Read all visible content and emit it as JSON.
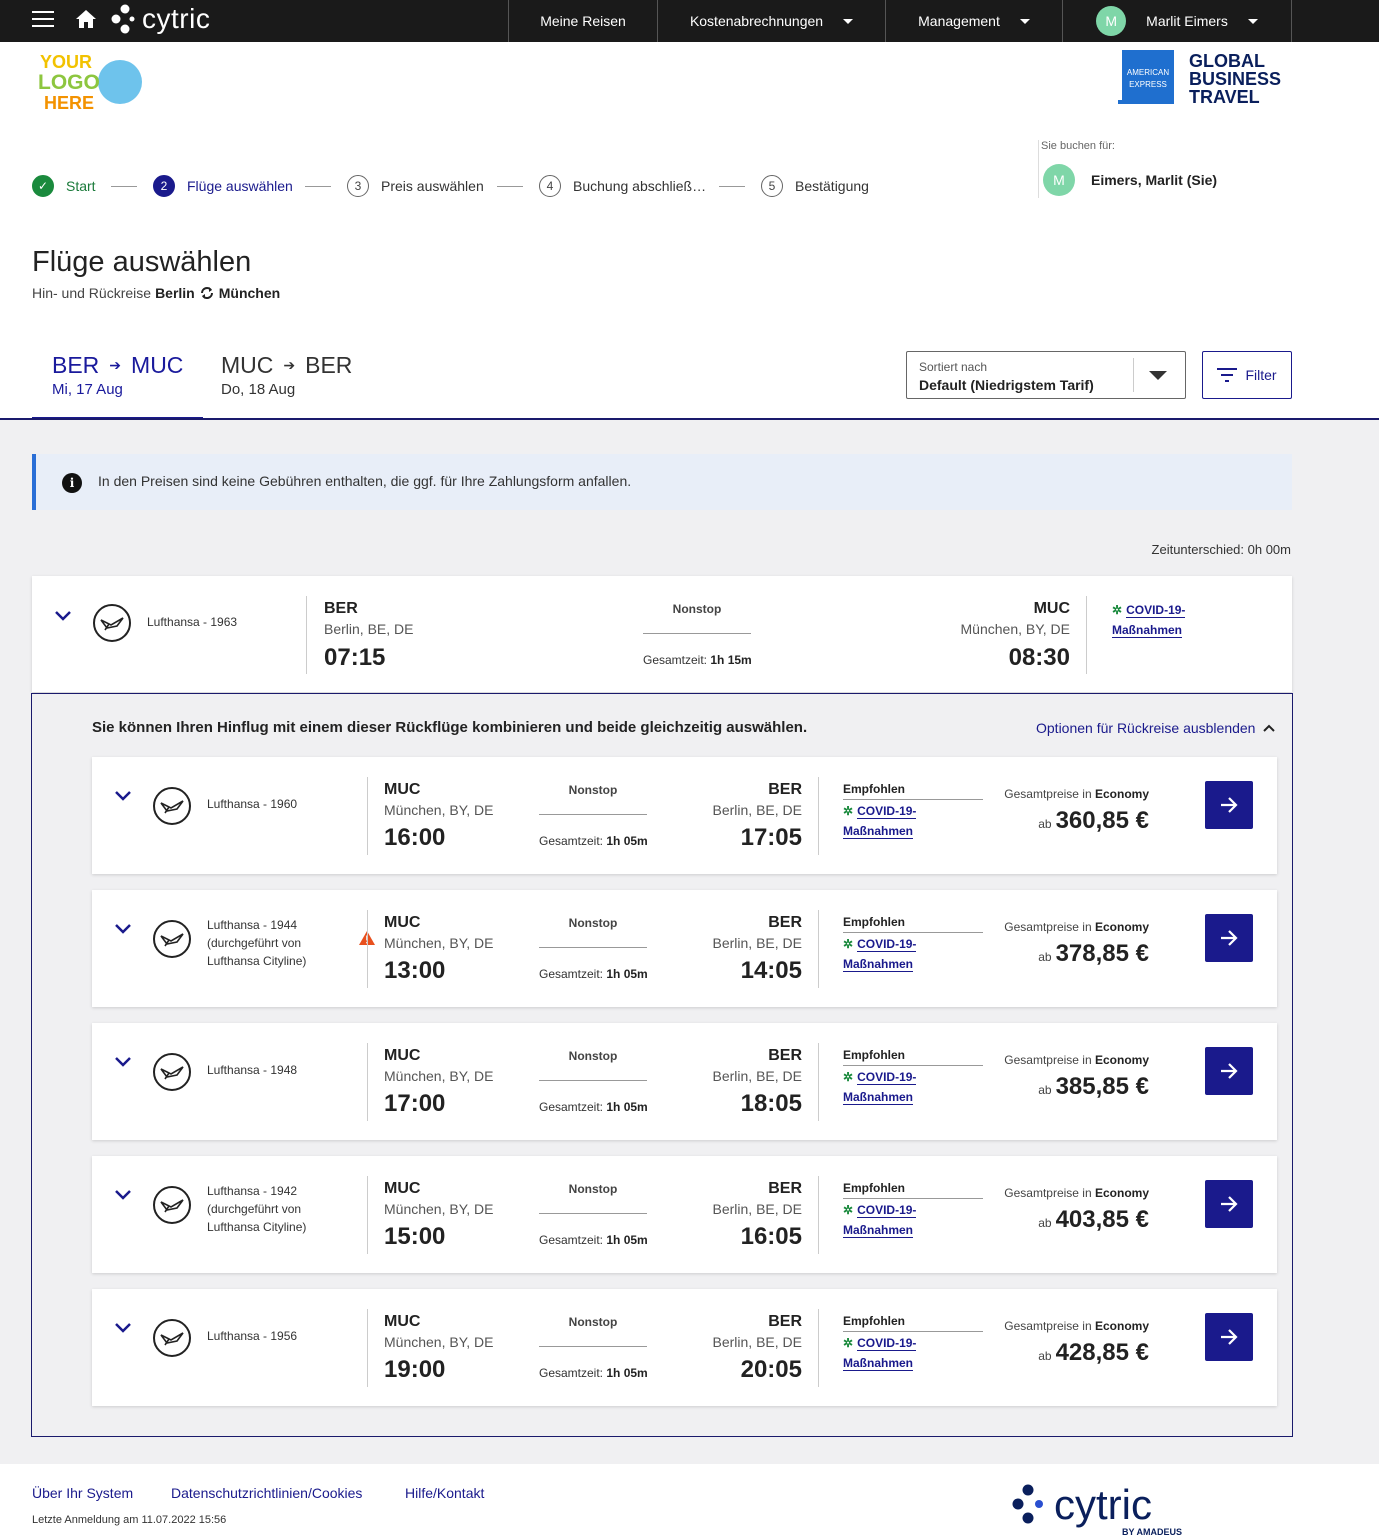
{
  "topbar": {
    "brand": "cytric",
    "nav": [
      {
        "label": "Meine Reisen",
        "dropdown": false
      },
      {
        "label": "Kostenabrechnungen",
        "dropdown": true
      },
      {
        "label": "Management",
        "dropdown": true
      }
    ],
    "user": {
      "initial": "M",
      "name": "Marlit Eimers"
    }
  },
  "logos": {
    "your_logo": [
      "YOUR",
      "LOGO",
      "HERE"
    ],
    "amex_badge": [
      "AMERICAN",
      "EXPRESS"
    ],
    "amex_text": [
      "GLOBAL",
      "BUSINESS",
      "TRAVEL"
    ]
  },
  "stepper": [
    {
      "num": "",
      "label": "Start",
      "state": "done"
    },
    {
      "num": "2",
      "label": "Flüge auswählen",
      "state": "active"
    },
    {
      "num": "3",
      "label": "Preis auswählen",
      "state": "todo"
    },
    {
      "num": "4",
      "label": "Buchung abschließ…",
      "state": "todo"
    },
    {
      "num": "5",
      "label": "Bestätigung",
      "state": "todo"
    }
  ],
  "booking_for": {
    "label": "Sie buchen für:",
    "initial": "M",
    "name": "Eimers, Marlit (Sie)"
  },
  "page": {
    "title": "Flüge auswählen",
    "subtitle_prefix": "Hin- und Rückreise",
    "from": "Berlin",
    "to": "München"
  },
  "tabs": [
    {
      "from": "BER",
      "to": "MUC",
      "date": "Mi, 17 Aug",
      "active": true
    },
    {
      "from": "MUC",
      "to": "BER",
      "date": "Do, 18 Aug",
      "active": false
    }
  ],
  "sort": {
    "label": "Sortiert nach",
    "value": "Default (Niedrigstem Tarif)"
  },
  "filter_label": "Filter",
  "info_text": "In den Preisen sind keine Gebühren enthalten, die ggf. für Ihre Zahlungsform anfallen.",
  "timezone_note": "Zeitunterschied: 0h 00m",
  "outbound": {
    "airline": "Lufthansa - 1963",
    "dep_code": "BER",
    "dep_city": "Berlin, BE, DE",
    "dep_time": "07:15",
    "stops": "Nonstop",
    "duration_label": "Gesamtzeit:",
    "duration": "1h 15m",
    "arr_code": "MUC",
    "arr_city": "München, BY, DE",
    "arr_time": "08:30",
    "covid": [
      "COVID-19-",
      "Maßnahmen"
    ]
  },
  "combo": {
    "title": "Sie können Ihren Hinflug mit einem dieser Rückflüge kombinieren und beide gleichzeitig auswählen.",
    "hide_label": "Optionen für Rückreise ausblenden"
  },
  "returns": [
    {
      "airline": [
        "Lufthansa - 1960"
      ],
      "warning": false,
      "dep_code": "MUC",
      "dep_city": "München, BY, DE",
      "dep_time": "16:00",
      "stops": "Nonstop",
      "duration_label": "Gesamtzeit:",
      "duration": "1h 05m",
      "arr_code": "BER",
      "arr_city": "Berlin, BE, DE",
      "arr_time": "17:05",
      "tag": "Empfohlen",
      "covid": [
        "COVID-19-",
        "Maßnahmen"
      ],
      "price_label": "Gesamtpreise in",
      "cabin": "Economy",
      "price_prefix": "ab",
      "price": "360,85 €"
    },
    {
      "airline": [
        "Lufthansa - 1944",
        "(durchgeführt von",
        "Lufthansa Cityline)"
      ],
      "warning": true,
      "dep_code": "MUC",
      "dep_city": "München, BY, DE",
      "dep_time": "13:00",
      "stops": "Nonstop",
      "duration_label": "Gesamtzeit:",
      "duration": "1h 05m",
      "arr_code": "BER",
      "arr_city": "Berlin, BE, DE",
      "arr_time": "14:05",
      "tag": "Empfohlen",
      "covid": [
        "COVID-19-",
        "Maßnahmen"
      ],
      "price_label": "Gesamtpreise in",
      "cabin": "Economy",
      "price_prefix": "ab",
      "price": "378,85 €"
    },
    {
      "airline": [
        "Lufthansa - 1948"
      ],
      "warning": false,
      "dep_code": "MUC",
      "dep_city": "München, BY, DE",
      "dep_time": "17:00",
      "stops": "Nonstop",
      "duration_label": "Gesamtzeit:",
      "duration": "1h 05m",
      "arr_code": "BER",
      "arr_city": "Berlin, BE, DE",
      "arr_time": "18:05",
      "tag": "Empfohlen",
      "covid": [
        "COVID-19-",
        "Maßnahmen"
      ],
      "price_label": "Gesamtpreise in",
      "cabin": "Economy",
      "price_prefix": "ab",
      "price": "385,85 €"
    },
    {
      "airline": [
        "Lufthansa - 1942",
        "(durchgeführt von",
        "Lufthansa Cityline)"
      ],
      "warning": false,
      "dep_code": "MUC",
      "dep_city": "München, BY, DE",
      "dep_time": "15:00",
      "stops": "Nonstop",
      "duration_label": "Gesamtzeit:",
      "duration": "1h 05m",
      "arr_code": "BER",
      "arr_city": "Berlin, BE, DE",
      "arr_time": "16:05",
      "tag": "Empfohlen",
      "covid": [
        "COVID-19-",
        "Maßnahmen"
      ],
      "price_label": "Gesamtpreise in",
      "cabin": "Economy",
      "price_prefix": "ab",
      "price": "403,85 €"
    },
    {
      "airline": [
        "Lufthansa - 1956"
      ],
      "warning": false,
      "dep_code": "MUC",
      "dep_city": "München, BY, DE",
      "dep_time": "19:00",
      "stops": "Nonstop",
      "duration_label": "Gesamtzeit:",
      "duration": "1h 05m",
      "arr_code": "BER",
      "arr_city": "Berlin, BE, DE",
      "arr_time": "20:05",
      "tag": "Empfohlen",
      "covid": [
        "COVID-19-",
        "Maßnahmen"
      ],
      "price_label": "Gesamtpreise in",
      "cabin": "Economy",
      "price_prefix": "ab",
      "price": "428,85 €"
    }
  ],
  "footer": {
    "links": [
      "Über Ihr System",
      "Datenschutzrichtlinien/Cookies",
      "Hilfe/Kontakt"
    ],
    "last_login": "Letzte Anmeldung am 11.07.2022 15:56",
    "brand": "cytric",
    "brand_sub": "BY AMADEUS"
  },
  "colors": {
    "primary": "#1a1a8c",
    "success": "#1a8a3d",
    "topbar": "#1a1a1a",
    "info_bg": "#e8eef8",
    "info_border": "#2a6ed6",
    "warning": "#e8501e"
  }
}
